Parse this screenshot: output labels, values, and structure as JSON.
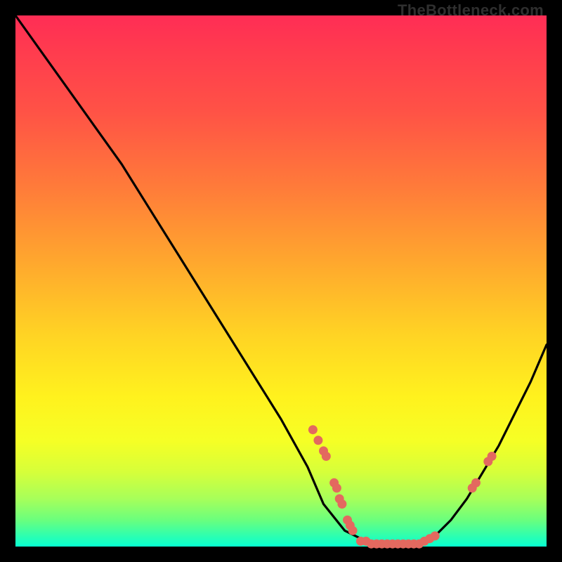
{
  "watermark": "TheBottleneck.com",
  "chart_data": {
    "type": "line",
    "title": "",
    "xlabel": "",
    "ylabel": "",
    "xlim": [
      0,
      100
    ],
    "ylim": [
      0,
      100
    ],
    "series": [
      {
        "name": "bottleneck-curve",
        "x": [
          0,
          5,
          10,
          15,
          20,
          25,
          30,
          35,
          40,
          45,
          50,
          55,
          58,
          62,
          66,
          70,
          73,
          76,
          79,
          82,
          85,
          88,
          91,
          94,
          97,
          100
        ],
        "y": [
          100,
          93,
          86,
          79,
          72,
          64,
          56,
          48,
          40,
          32,
          24,
          15,
          8,
          3,
          1,
          0,
          0,
          0,
          2,
          5,
          9,
          14,
          19,
          25,
          31,
          38
        ]
      }
    ],
    "markers": {
      "name": "hardware-points",
      "points": [
        {
          "x": 56,
          "y": 22
        },
        {
          "x": 57,
          "y": 20
        },
        {
          "x": 58,
          "y": 18
        },
        {
          "x": 58.5,
          "y": 17
        },
        {
          "x": 60,
          "y": 12
        },
        {
          "x": 60.5,
          "y": 11
        },
        {
          "x": 61,
          "y": 9
        },
        {
          "x": 61.5,
          "y": 8
        },
        {
          "x": 62.5,
          "y": 5
        },
        {
          "x": 63,
          "y": 4
        },
        {
          "x": 63.5,
          "y": 3
        },
        {
          "x": 65,
          "y": 1
        },
        {
          "x": 66,
          "y": 1
        },
        {
          "x": 67,
          "y": 0.5
        },
        {
          "x": 68,
          "y": 0.5
        },
        {
          "x": 69,
          "y": 0.5
        },
        {
          "x": 70,
          "y": 0.5
        },
        {
          "x": 71,
          "y": 0.5
        },
        {
          "x": 72,
          "y": 0.5
        },
        {
          "x": 73,
          "y": 0.5
        },
        {
          "x": 74,
          "y": 0.5
        },
        {
          "x": 75,
          "y": 0.5
        },
        {
          "x": 76,
          "y": 0.5
        },
        {
          "x": 77,
          "y": 1
        },
        {
          "x": 78,
          "y": 1.5
        },
        {
          "x": 79,
          "y": 2
        },
        {
          "x": 86,
          "y": 11
        },
        {
          "x": 86.7,
          "y": 12
        },
        {
          "x": 89,
          "y": 16
        },
        {
          "x": 89.7,
          "y": 17
        }
      ]
    },
    "background_gradient": {
      "top": "#ff2d55",
      "mid": "#fff21e",
      "bottom": "#07ffd0"
    }
  }
}
